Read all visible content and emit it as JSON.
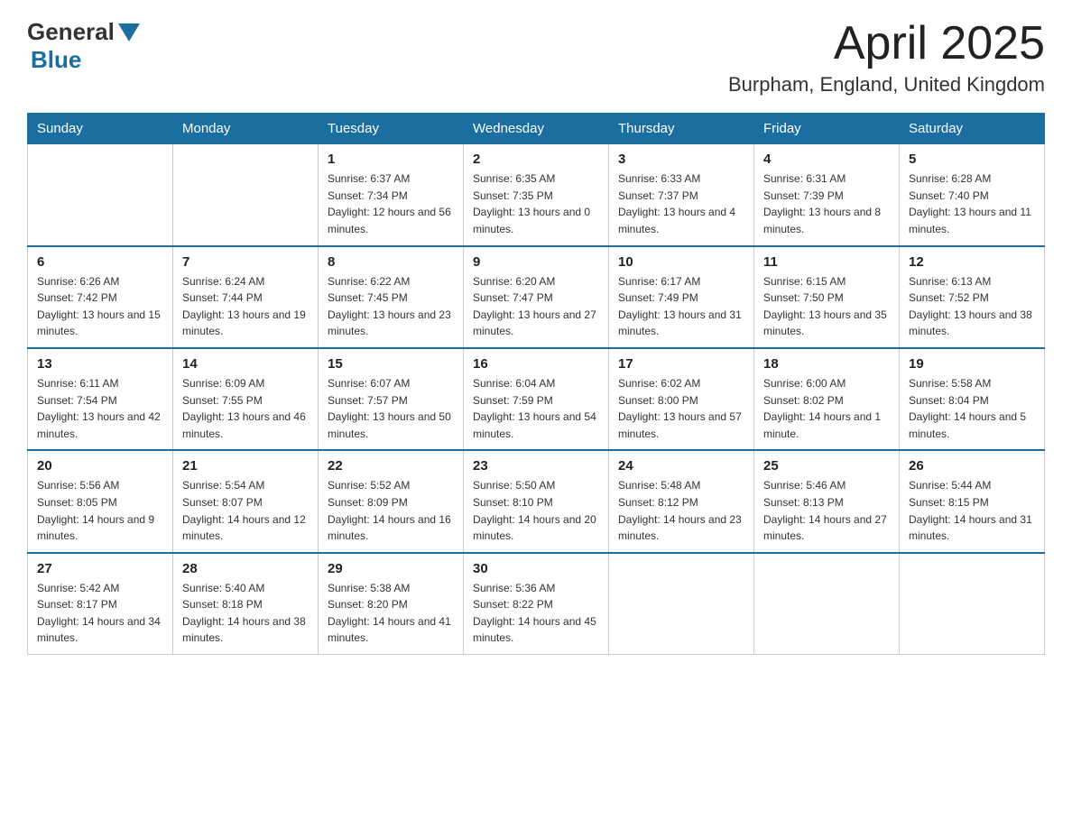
{
  "header": {
    "logo_general": "General",
    "logo_blue": "Blue",
    "month_year": "April 2025",
    "location": "Burpham, England, United Kingdom"
  },
  "weekdays": [
    "Sunday",
    "Monday",
    "Tuesday",
    "Wednesday",
    "Thursday",
    "Friday",
    "Saturday"
  ],
  "weeks": [
    [
      {
        "day": "",
        "sunrise": "",
        "sunset": "",
        "daylight": ""
      },
      {
        "day": "",
        "sunrise": "",
        "sunset": "",
        "daylight": ""
      },
      {
        "day": "1",
        "sunrise": "Sunrise: 6:37 AM",
        "sunset": "Sunset: 7:34 PM",
        "daylight": "Daylight: 12 hours and 56 minutes."
      },
      {
        "day": "2",
        "sunrise": "Sunrise: 6:35 AM",
        "sunset": "Sunset: 7:35 PM",
        "daylight": "Daylight: 13 hours and 0 minutes."
      },
      {
        "day": "3",
        "sunrise": "Sunrise: 6:33 AM",
        "sunset": "Sunset: 7:37 PM",
        "daylight": "Daylight: 13 hours and 4 minutes."
      },
      {
        "day": "4",
        "sunrise": "Sunrise: 6:31 AM",
        "sunset": "Sunset: 7:39 PM",
        "daylight": "Daylight: 13 hours and 8 minutes."
      },
      {
        "day": "5",
        "sunrise": "Sunrise: 6:28 AM",
        "sunset": "Sunset: 7:40 PM",
        "daylight": "Daylight: 13 hours and 11 minutes."
      }
    ],
    [
      {
        "day": "6",
        "sunrise": "Sunrise: 6:26 AM",
        "sunset": "Sunset: 7:42 PM",
        "daylight": "Daylight: 13 hours and 15 minutes."
      },
      {
        "day": "7",
        "sunrise": "Sunrise: 6:24 AM",
        "sunset": "Sunset: 7:44 PM",
        "daylight": "Daylight: 13 hours and 19 minutes."
      },
      {
        "day": "8",
        "sunrise": "Sunrise: 6:22 AM",
        "sunset": "Sunset: 7:45 PM",
        "daylight": "Daylight: 13 hours and 23 minutes."
      },
      {
        "day": "9",
        "sunrise": "Sunrise: 6:20 AM",
        "sunset": "Sunset: 7:47 PM",
        "daylight": "Daylight: 13 hours and 27 minutes."
      },
      {
        "day": "10",
        "sunrise": "Sunrise: 6:17 AM",
        "sunset": "Sunset: 7:49 PM",
        "daylight": "Daylight: 13 hours and 31 minutes."
      },
      {
        "day": "11",
        "sunrise": "Sunrise: 6:15 AM",
        "sunset": "Sunset: 7:50 PM",
        "daylight": "Daylight: 13 hours and 35 minutes."
      },
      {
        "day": "12",
        "sunrise": "Sunrise: 6:13 AM",
        "sunset": "Sunset: 7:52 PM",
        "daylight": "Daylight: 13 hours and 38 minutes."
      }
    ],
    [
      {
        "day": "13",
        "sunrise": "Sunrise: 6:11 AM",
        "sunset": "Sunset: 7:54 PM",
        "daylight": "Daylight: 13 hours and 42 minutes."
      },
      {
        "day": "14",
        "sunrise": "Sunrise: 6:09 AM",
        "sunset": "Sunset: 7:55 PM",
        "daylight": "Daylight: 13 hours and 46 minutes."
      },
      {
        "day": "15",
        "sunrise": "Sunrise: 6:07 AM",
        "sunset": "Sunset: 7:57 PM",
        "daylight": "Daylight: 13 hours and 50 minutes."
      },
      {
        "day": "16",
        "sunrise": "Sunrise: 6:04 AM",
        "sunset": "Sunset: 7:59 PM",
        "daylight": "Daylight: 13 hours and 54 minutes."
      },
      {
        "day": "17",
        "sunrise": "Sunrise: 6:02 AM",
        "sunset": "Sunset: 8:00 PM",
        "daylight": "Daylight: 13 hours and 57 minutes."
      },
      {
        "day": "18",
        "sunrise": "Sunrise: 6:00 AM",
        "sunset": "Sunset: 8:02 PM",
        "daylight": "Daylight: 14 hours and 1 minute."
      },
      {
        "day": "19",
        "sunrise": "Sunrise: 5:58 AM",
        "sunset": "Sunset: 8:04 PM",
        "daylight": "Daylight: 14 hours and 5 minutes."
      }
    ],
    [
      {
        "day": "20",
        "sunrise": "Sunrise: 5:56 AM",
        "sunset": "Sunset: 8:05 PM",
        "daylight": "Daylight: 14 hours and 9 minutes."
      },
      {
        "day": "21",
        "sunrise": "Sunrise: 5:54 AM",
        "sunset": "Sunset: 8:07 PM",
        "daylight": "Daylight: 14 hours and 12 minutes."
      },
      {
        "day": "22",
        "sunrise": "Sunrise: 5:52 AM",
        "sunset": "Sunset: 8:09 PM",
        "daylight": "Daylight: 14 hours and 16 minutes."
      },
      {
        "day": "23",
        "sunrise": "Sunrise: 5:50 AM",
        "sunset": "Sunset: 8:10 PM",
        "daylight": "Daylight: 14 hours and 20 minutes."
      },
      {
        "day": "24",
        "sunrise": "Sunrise: 5:48 AM",
        "sunset": "Sunset: 8:12 PM",
        "daylight": "Daylight: 14 hours and 23 minutes."
      },
      {
        "day": "25",
        "sunrise": "Sunrise: 5:46 AM",
        "sunset": "Sunset: 8:13 PM",
        "daylight": "Daylight: 14 hours and 27 minutes."
      },
      {
        "day": "26",
        "sunrise": "Sunrise: 5:44 AM",
        "sunset": "Sunset: 8:15 PM",
        "daylight": "Daylight: 14 hours and 31 minutes."
      }
    ],
    [
      {
        "day": "27",
        "sunrise": "Sunrise: 5:42 AM",
        "sunset": "Sunset: 8:17 PM",
        "daylight": "Daylight: 14 hours and 34 minutes."
      },
      {
        "day": "28",
        "sunrise": "Sunrise: 5:40 AM",
        "sunset": "Sunset: 8:18 PM",
        "daylight": "Daylight: 14 hours and 38 minutes."
      },
      {
        "day": "29",
        "sunrise": "Sunrise: 5:38 AM",
        "sunset": "Sunset: 8:20 PM",
        "daylight": "Daylight: 14 hours and 41 minutes."
      },
      {
        "day": "30",
        "sunrise": "Sunrise: 5:36 AM",
        "sunset": "Sunset: 8:22 PM",
        "daylight": "Daylight: 14 hours and 45 minutes."
      },
      {
        "day": "",
        "sunrise": "",
        "sunset": "",
        "daylight": ""
      },
      {
        "day": "",
        "sunrise": "",
        "sunset": "",
        "daylight": ""
      },
      {
        "day": "",
        "sunrise": "",
        "sunset": "",
        "daylight": ""
      }
    ]
  ]
}
